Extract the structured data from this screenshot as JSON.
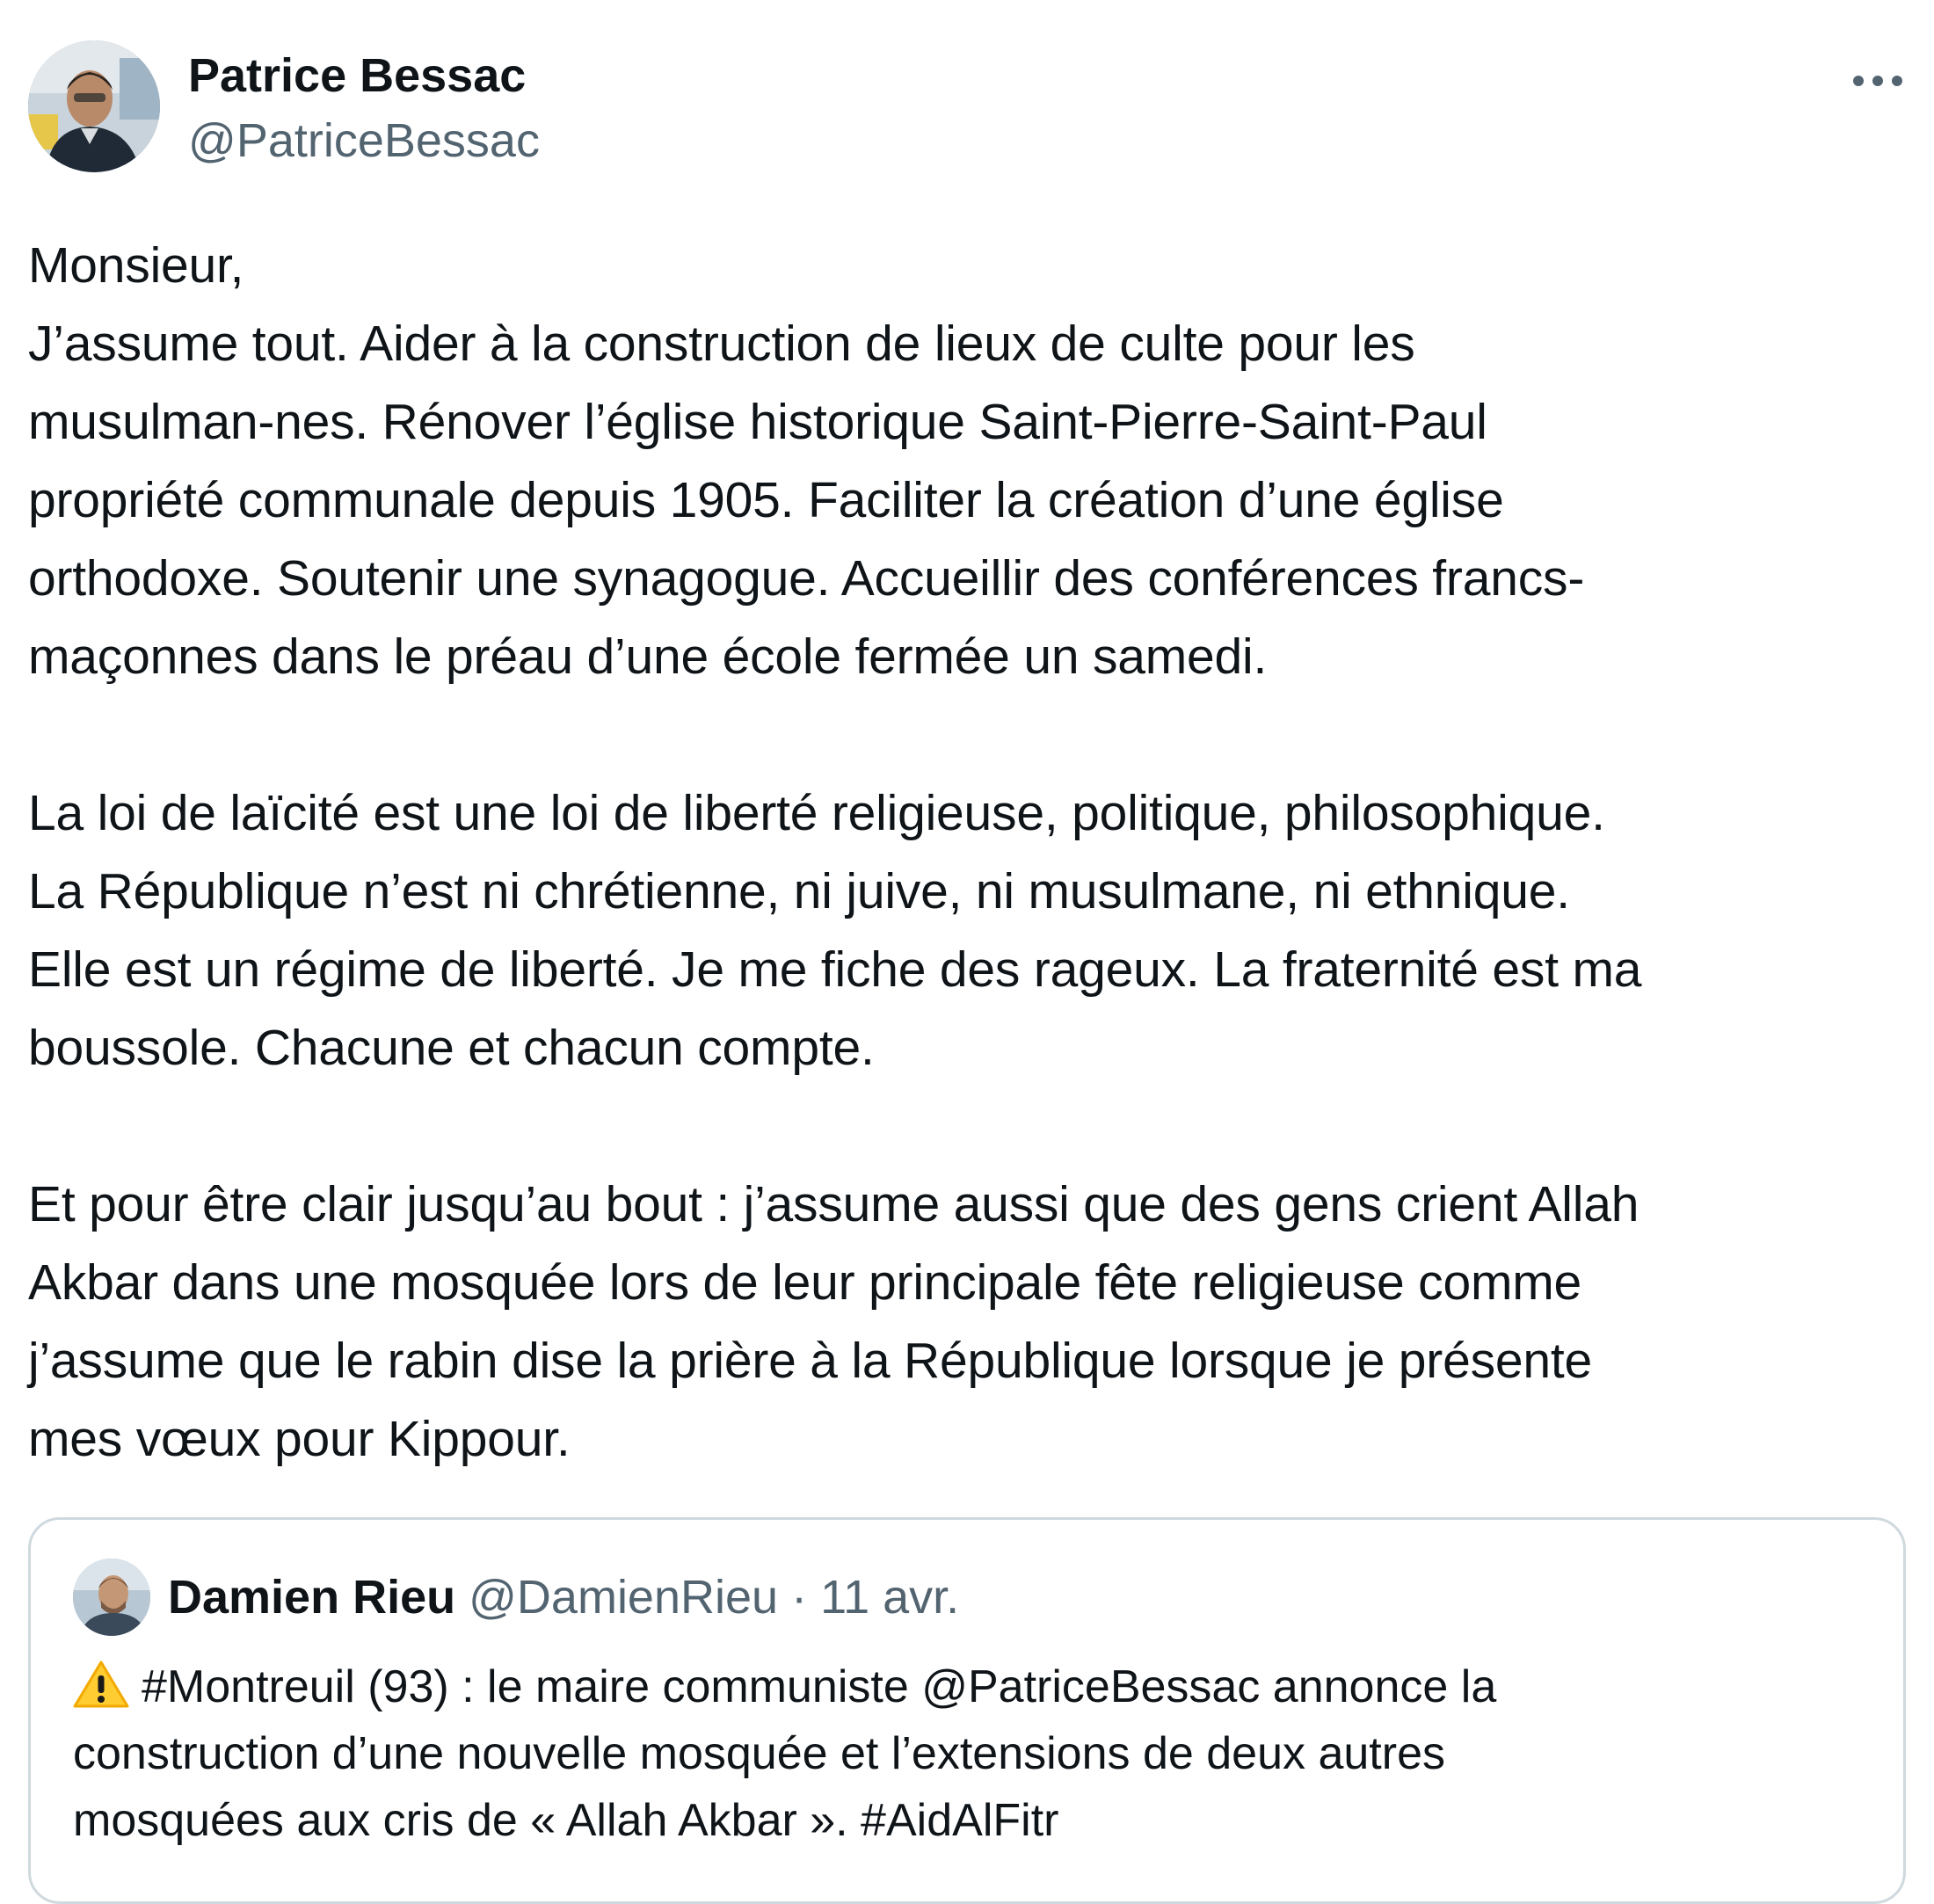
{
  "tweet": {
    "author_name": "Patrice Bessac",
    "author_handle": "@PatriceBessac",
    "more_icon": "more-horizontal-icon",
    "body": [
      "Monsieur,",
      "J’assume tout. Aider à la construction de lieux de culte pour les",
      "musulman-nes. Rénover l’église historique Saint-Pierre-Saint-Paul",
      "propriété communale depuis 1905. Faciliter la création d’une église",
      "orthodoxe. Soutenir une synagogue. Accueillir des conférences francs-",
      "maçonnes dans le préau d’une école fermée un samedi.",
      "",
      "La loi de laïcité est une loi de liberté religieuse, politique, philosophique.",
      "La République n’est ni chrétienne, ni juive, ni musulmane, ni ethnique.",
      "Elle est un régime de liberté. Je me fiche des rageux. La fraternité est ma",
      "boussole. Chacune et chacun compte.",
      "",
      "Et pour être clair jusqu’au bout : j’assume aussi que des gens crient Allah",
      "Akbar dans une mosquée lors de leur principale fête religieuse comme",
      "j’assume que le rabin dise la prière à la République lorsque je présente",
      "mes vœux pour Kippour."
    ]
  },
  "quoted_tweet": {
    "author_name": "Damien Rieu",
    "author_handle": "@DamienRieu",
    "separator": "·",
    "date": "11 avr.",
    "warning_icon": "warning-icon",
    "text_lines": [
      "#Montreuil (93) : le maire communiste  @PatriceBessac annonce la",
      "construction d’une nouvelle mosquée et l’extensions de deux autres",
      "mosquées aux cris de « Allah Akbar ». #AidAlFitr"
    ]
  },
  "colors": {
    "text": "#0f1419",
    "secondary": "#536471",
    "border": "#cfd9de",
    "warning": "#ffcc32"
  }
}
